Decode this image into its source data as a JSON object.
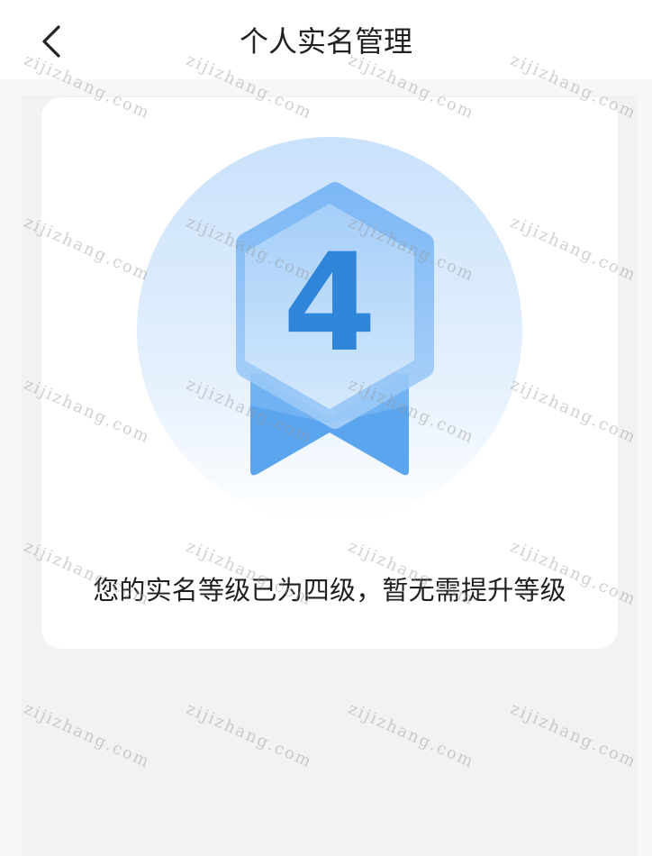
{
  "header": {
    "title": "个人实名管理"
  },
  "badge": {
    "level_number": "4",
    "colors": {
      "circle_top": "#cfe4fb",
      "circle_bottom": "#ffffff",
      "hex_outer": "#7fb9f5",
      "hex_inner": "#b9dafa",
      "ribbon": "#4a9be8",
      "digit": "#2f86d9"
    }
  },
  "card": {
    "status_text": "您的实名等级已为四级，暂无需提升等级"
  },
  "watermark": {
    "text": "zijizhang.com"
  },
  "icons": {
    "back": "chevron-left-icon",
    "badge": "medal-icon"
  }
}
